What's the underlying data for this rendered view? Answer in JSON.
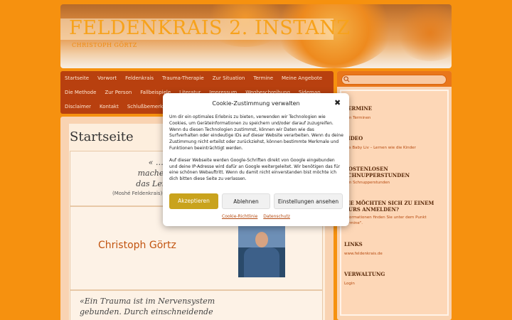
{
  "site": {
    "title": "FELDENKRAIS 2. INSTANZ",
    "subtitle": "CHRISTOPH GÖRTZ"
  },
  "nav": {
    "row1": [
      "Startseite",
      "Vorwort",
      "Feldenkrais",
      "Trauma-Therapie",
      "Zur Situation",
      "Termine",
      "Meine Angebote"
    ],
    "row2": [
      "Die Methode",
      "Zur Person",
      "Fallbeispiele",
      "Literatur",
      "Impressum",
      "Wegbeschreibung",
      "Sidemap"
    ],
    "row3": [
      "Disclaimer",
      "Kontakt",
      "Schlußbemerkung"
    ]
  },
  "main": {
    "page_title": "Startseite",
    "quote_line1": "« … das Unmögliche m",
    "quote_line2": "machen, das Mögliche le",
    "quote_line3": "das Leichte elegant",
    "quote_author": "(Moshé Feldenkrais)",
    "person_name": "Christoph Görtz",
    "trauma_line1": "«Ein Trauma ist im Nervensystem",
    "trauma_line2": "gebunden. Durch einschneidende"
  },
  "sidebar": {
    "search_placeholder": "",
    "sections": [
      {
        "heading": "TERMINE",
        "link": "den Terminen"
      },
      {
        "heading": "VIDEO",
        "link": "eos Baby Liv – Lernen wie die Kinder"
      },
      {
        "heading": "KOSTENLOSEN SCHNUPPERSTUNDEN",
        "link": "den Schnupperstunden"
      },
      {
        "heading": "SIE MÖCHTEN SICH ZU EINEM KURS ANMELDEN?",
        "link": "Informationen finden Sie unter dem Punkt Termine\"."
      },
      {
        "heading": "LINKS",
        "link": "www.feldenkrais.de"
      },
      {
        "heading": "VERWALTUNG",
        "link": "Login"
      }
    ]
  },
  "cookie": {
    "title": "Cookie-Zustimmung verwalten",
    "text1": "Um dir ein optimales Erlebnis zu bieten, verwenden wir Technologien wie Cookies, um Geräteinformationen zu speichern und/oder darauf zuzugreifen. Wenn du diesen Technologien zustimmst, können wir Daten wie das Surfverhalten oder eindeutige IDs auf dieser Website verarbeiten. Wenn du deine Zustimmung nicht erteilst oder zurückziehst, können bestimmte Merkmale und Funktionen beeinträchtigt werden.",
    "text2": "Auf dieser Webseite werden Google-Schriften direkt von Google eingebunden und deine IP-Adresse wird dafür an Google weitergeleitet. Wir benötigen das für eine schönen Webauftritt. Wenn du damit nicht einverstanden bist möchte ich dich bitten diese Seite zu verlassen.",
    "accept": "Akzeptieren",
    "deny": "Ablehnen",
    "settings": "Einstellungen ansehen",
    "link_policy": "Cookie-Richtlinie",
    "link_privacy": "Datenschutz"
  }
}
